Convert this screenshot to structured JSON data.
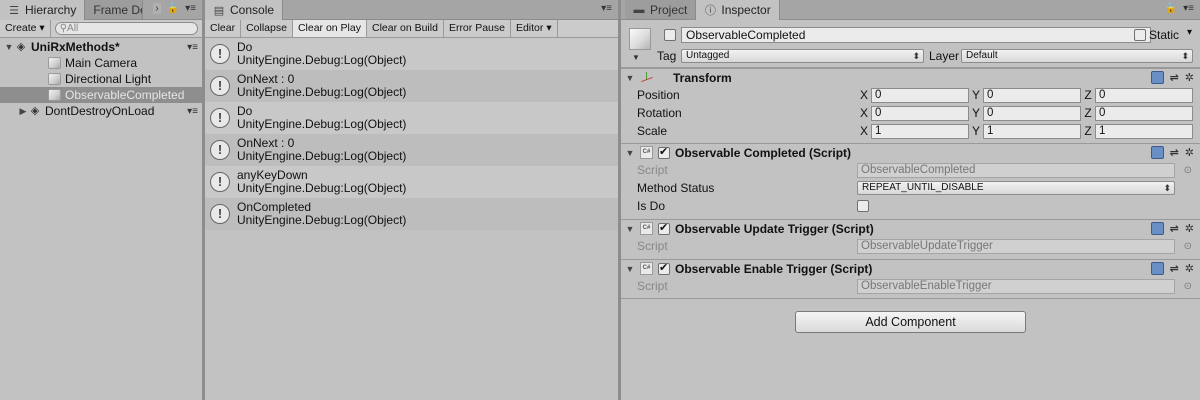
{
  "hierarchy": {
    "tabs": [
      {
        "label": "Hierarchy",
        "icon": "list-icon"
      },
      {
        "label": "Frame De",
        "icon": ""
      }
    ],
    "create_label": "Create",
    "search_placeholder": "All",
    "scene_name": "UniRxMethods*",
    "items": [
      {
        "label": "Main Camera"
      },
      {
        "label": "Directional Light"
      },
      {
        "label": "ObservableCompleted"
      }
    ],
    "dont_destroy_label": "DontDestroyOnLoad"
  },
  "console": {
    "tab_label": "Console",
    "toolbar": [
      "Clear",
      "Collapse",
      "Clear on Play",
      "Clear on Build",
      "Error Pause",
      "Editor"
    ],
    "logs": [
      {
        "line1": "Do",
        "line2": "UnityEngine.Debug:Log(Object)"
      },
      {
        "line1": "OnNext : 0",
        "line2": "UnityEngine.Debug:Log(Object)"
      },
      {
        "line1": "Do",
        "line2": "UnityEngine.Debug:Log(Object)"
      },
      {
        "line1": "OnNext : 0",
        "line2": "UnityEngine.Debug:Log(Object)"
      },
      {
        "line1": "anyKeyDown",
        "line2": "UnityEngine.Debug:Log(Object)"
      },
      {
        "line1": "OnCompleted",
        "line2": "UnityEngine.Debug:Log(Object)"
      }
    ]
  },
  "inspector": {
    "tabs": [
      {
        "label": "Project"
      },
      {
        "label": "Inspector"
      }
    ],
    "object_name": "ObservableCompleted",
    "static_label": "Static",
    "tag_label": "Tag",
    "tag_value": "Untagged",
    "layer_label": "Layer",
    "layer_value": "Default",
    "transform": {
      "title": "Transform",
      "rows": [
        {
          "label": "Position",
          "x": "0",
          "y": "0",
          "z": "0"
        },
        {
          "label": "Rotation",
          "x": "0",
          "y": "0",
          "z": "0"
        },
        {
          "label": "Scale",
          "x": "1",
          "y": "1",
          "z": "1"
        }
      ],
      "axis_x": "X",
      "axis_y": "Y",
      "axis_z": "Z"
    },
    "components": [
      {
        "title": "Observable Completed (Script)",
        "script_label": "Script",
        "script_value": "ObservableCompleted",
        "method_status_label": "Method Status",
        "method_status_value": "REPEAT_UNTIL_DISABLE",
        "is_do_label": "Is Do"
      },
      {
        "title": "Observable Update Trigger (Script)",
        "script_label": "Script",
        "script_value": "ObservableUpdateTrigger"
      },
      {
        "title": "Observable Enable Trigger (Script)",
        "script_label": "Script",
        "script_value": "ObservableEnableTrigger"
      }
    ],
    "add_component_label": "Add Component",
    "cs_icon_text": "C#"
  }
}
